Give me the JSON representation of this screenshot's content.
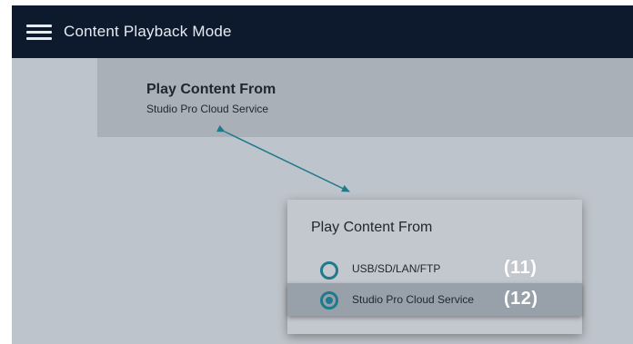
{
  "header": {
    "title": "Content Playback Mode",
    "menu_icon": "hamburger-menu-icon"
  },
  "setting": {
    "title": "Play Content From",
    "value": "Studio Pro Cloud Service"
  },
  "annotation": {
    "arrow_color": "#1f7a8c"
  },
  "popup": {
    "title": "Play Content From",
    "options": [
      {
        "label": "USB/SD/LAN/FTP",
        "badge": "(11)",
        "selected": false
      },
      {
        "label": "Studio Pro Cloud Service",
        "badge": "(12)",
        "selected": true
      }
    ]
  },
  "colors": {
    "topbar": "#0d1a2d",
    "background": "#bec4cb",
    "accent": "#1f7a8c"
  }
}
